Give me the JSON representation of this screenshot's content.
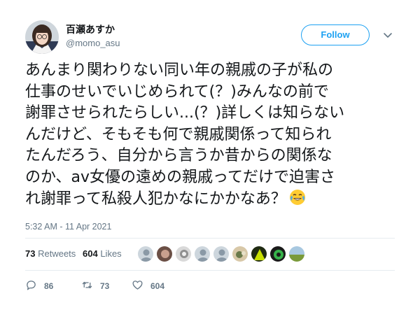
{
  "user": {
    "name": "百瀬あすか",
    "handle": "@momo_asu"
  },
  "follow_label": "Follow",
  "tweet": {
    "lines": [
      "あんまり関わりない同い年の親戚の子が私の",
      "仕事のせいでいじめられて(？)みんなの前で",
      "謝罪させられたらしい...(？)詳しくは知らない",
      "んだけど、そもそも何で親戚関係って知られ",
      "たんだろう、自分から言うか昔からの関係な",
      "のか、av女優の遠めの親戚ってだけで迫害さ",
      "れ謝罪って私殺人犯かなにかかなあ？"
    ],
    "emoji": "face-with-tears-of-joy-icon"
  },
  "timestamp": "5:32 AM - 11 Apr 2021",
  "stats": {
    "retweets_count": "73",
    "retweets_label": "Retweets",
    "likes_count": "604",
    "likes_label": "Likes"
  },
  "actions": {
    "replies": "86",
    "retweets": "73",
    "likes": "604"
  },
  "colors": {
    "accent": "#1da1f2",
    "text": "#14171a",
    "muted": "#657786",
    "divider": "#e6ecf0"
  }
}
